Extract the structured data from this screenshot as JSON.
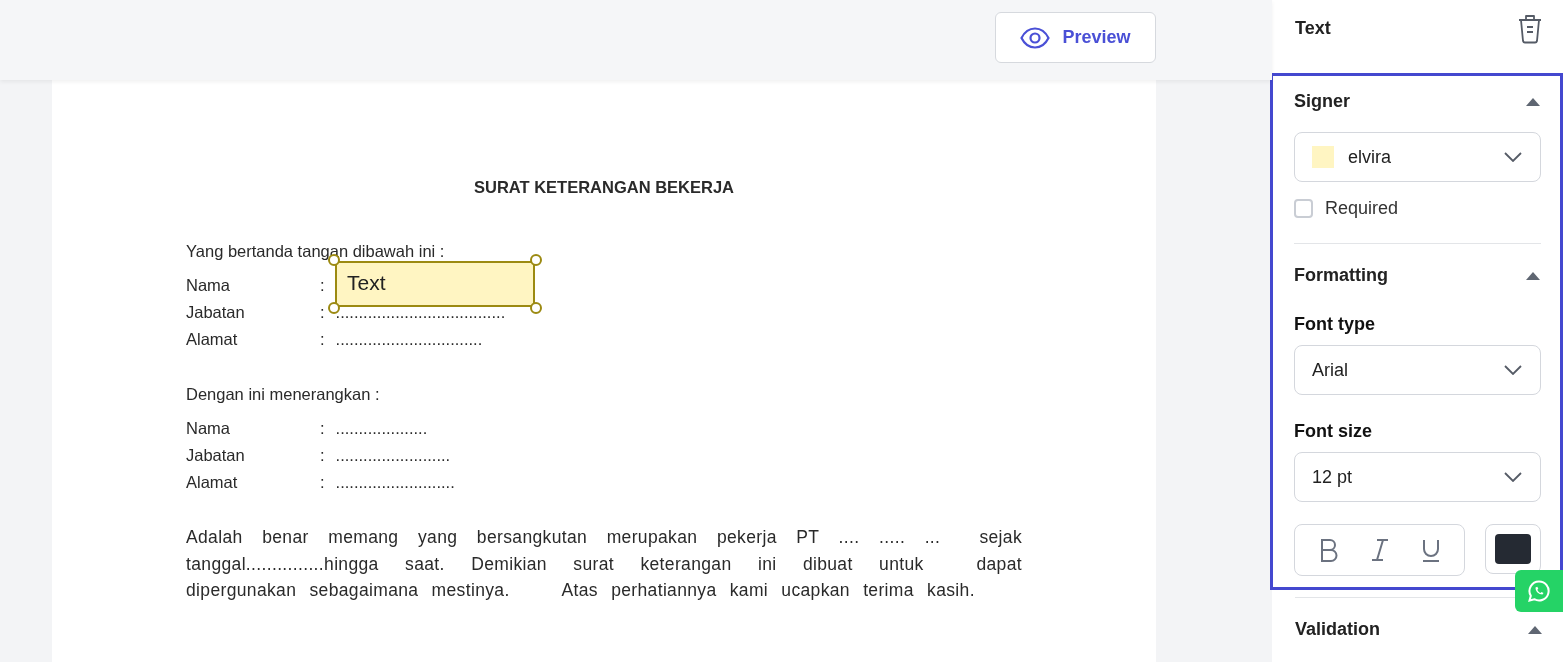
{
  "toolbar": {
    "preview_button": "Preview"
  },
  "document": {
    "title": "SURAT KETERANGAN BEKERJA",
    "sections": [
      {
        "heading": "Yang bertanda tangan dibawah ini :",
        "fields": [
          {
            "label": "Nama",
            "separator": ":"
          },
          {
            "label": "Jabatan",
            "separator": ":",
            "value": "....................................."
          },
          {
            "label": "Alamat",
            "separator": ":",
            "value": "................................"
          }
        ]
      },
      {
        "heading": "Dengan ini menerangkan :",
        "fields": [
          {
            "label": "Nama",
            "separator": ":",
            "value": "...................."
          },
          {
            "label": "Jabatan",
            "separator": ":",
            "value": "........................."
          },
          {
            "label": "Alamat",
            "separator": ":",
            "value": ".........................."
          }
        ]
      }
    ],
    "paragraph": "Adalah benar memang yang bersangkutan merupakan pekerja PT .... ..... ...  sejak tanggal...............hingga saat. Demikian surat keterangan ini dibuat untuk  dapat dipergunakan sebagaimana mestinya.    Atas perhatiannya kami ucapkan terima kasih.",
    "placed_field": {
      "label": "Text",
      "color": "#fff5c2",
      "selected": true
    }
  },
  "panel": {
    "title": "Text",
    "highlighted": true,
    "signer": {
      "heading": "Signer",
      "expanded": true,
      "value": "elvira",
      "color": "#fff5c2",
      "required": {
        "label": "Required",
        "checked": false
      }
    },
    "formatting": {
      "heading": "Formatting",
      "expanded": true,
      "font_type": {
        "label": "Font type",
        "value": "Arial"
      },
      "font_size": {
        "label": "Font size",
        "value": "12 pt"
      },
      "styles": [
        {
          "kind": "bold",
          "on": false
        },
        {
          "kind": "italic",
          "on": false
        },
        {
          "kind": "underline",
          "on": false
        }
      ],
      "color": "#252a33"
    },
    "validation": {
      "heading": "Validation",
      "expanded": true
    }
  }
}
